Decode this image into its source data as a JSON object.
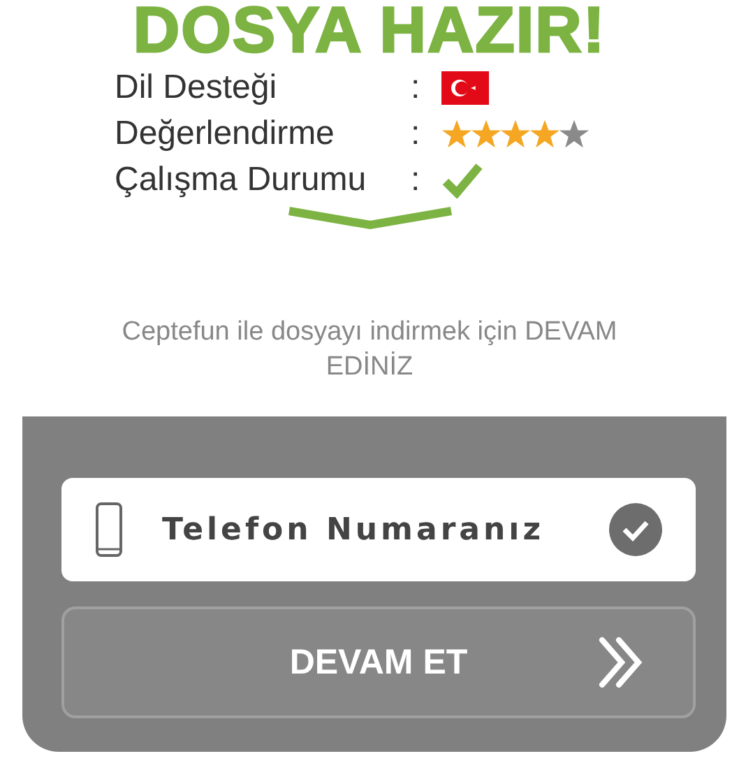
{
  "title": "DOSYA HAZIR!",
  "info_rows": [
    {
      "label": "Dil Desteği",
      "separator": ":",
      "kind": "flag"
    },
    {
      "label": "Değerlendirme",
      "separator": ":",
      "kind": "stars",
      "stars": 4
    },
    {
      "label": "Çalışma Durumu",
      "separator": ":",
      "kind": "check"
    }
  ],
  "instruction": "Ceptefun ile dosyayı indirmek için DEVAM EDİNİZ",
  "phone_field": {
    "placeholder": "Telefon Numaranız"
  },
  "continue_button": {
    "label": "DEVAM ET"
  }
}
